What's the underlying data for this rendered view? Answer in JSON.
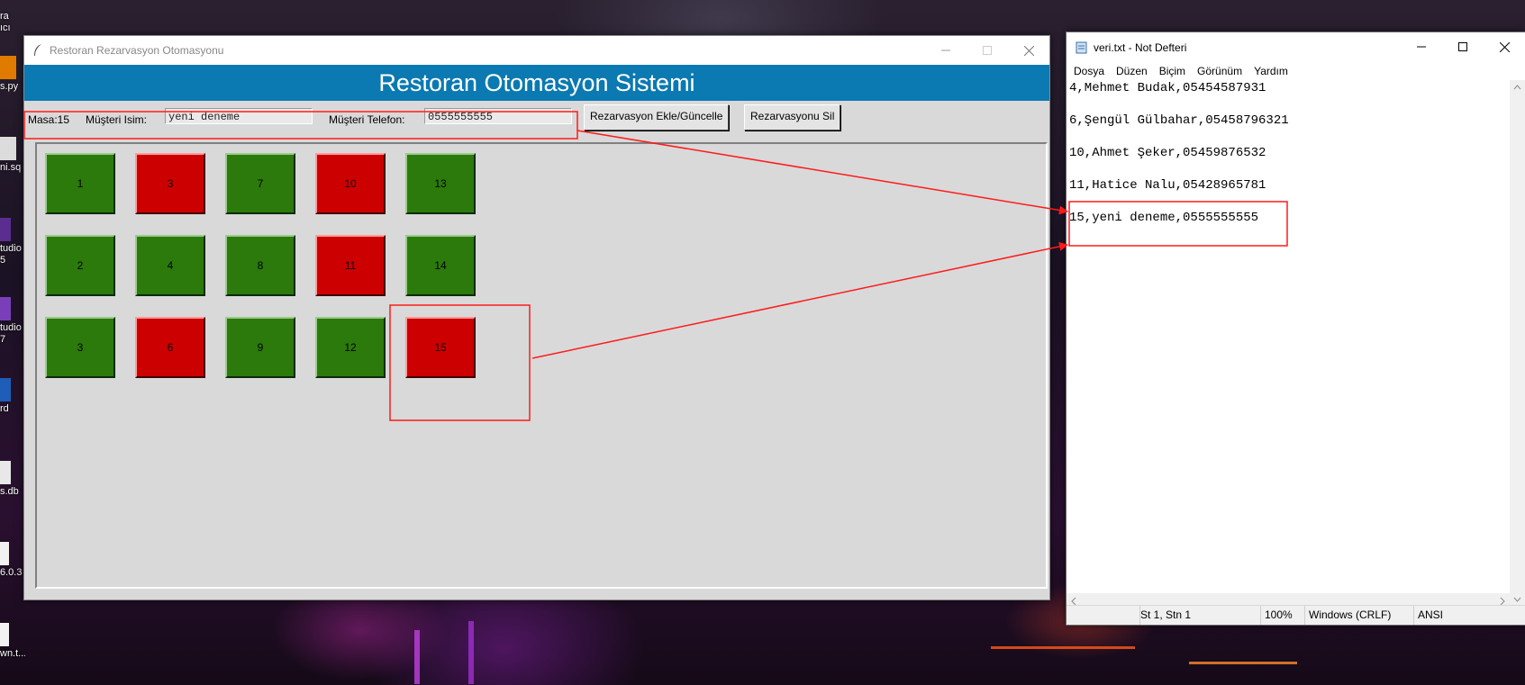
{
  "desktop": {
    "icons": [
      {
        "label": "ra\nıcı"
      },
      {
        "label": "s.py"
      },
      {
        "label": "ni.sq"
      },
      {
        "label": "tudio\n5"
      },
      {
        "label": "tudio\n7"
      },
      {
        "label": "rd"
      },
      {
        "label": "s.db"
      },
      {
        "label": "6.0.3"
      },
      {
        "label": "wn.t..."
      }
    ]
  },
  "tk_window": {
    "title": "Restoran Rezarvasyon Otomasyonu",
    "banner": "Restoran Otomasyon Sistemi",
    "banner_color": "#0b79b2",
    "masa_label": "Masa:15",
    "name_label": "Müşteri Isim:",
    "name_value": "yeni deneme",
    "phone_label": "Müşteri Telefon:",
    "phone_value": "0555555555",
    "add_button": "Rezarvasyon Ekle/Güncelle",
    "delete_button": "Rezarvasyonu Sil",
    "free_color": "#2b7a0b",
    "busy_color": "#cc0000",
    "tables": [
      {
        "label": "1",
        "status": "free"
      },
      {
        "label": "3",
        "status": "busy"
      },
      {
        "label": "7",
        "status": "free"
      },
      {
        "label": "10",
        "status": "busy"
      },
      {
        "label": "13",
        "status": "free"
      },
      {
        "label": "2",
        "status": "free"
      },
      {
        "label": "4",
        "status": "free"
      },
      {
        "label": "8",
        "status": "free"
      },
      {
        "label": "11",
        "status": "busy"
      },
      {
        "label": "14",
        "status": "free"
      },
      {
        "label": "3",
        "status": "free"
      },
      {
        "label": "6",
        "status": "busy"
      },
      {
        "label": "9",
        "status": "free"
      },
      {
        "label": "12",
        "status": "free"
      },
      {
        "label": "15",
        "status": "busy"
      }
    ]
  },
  "notepad": {
    "title": "veri.txt - Not Defteri",
    "menu": [
      "Dosya",
      "Düzen",
      "Biçim",
      "Görünüm",
      "Yardım"
    ],
    "lines": [
      "4,Mehmet Budak,05454587931",
      "6,Şengül Gülbahar,05458796321",
      "10,Ahmet Şeker,05459876532",
      "11,Hatice Nalu,05428965781",
      "15,yeni deneme,0555555555"
    ],
    "status": {
      "position": "St 1, Stn 1",
      "zoom": "100%",
      "line_endings": "Windows (CRLF)",
      "encoding": "ANSI"
    }
  },
  "annotation_color": "#ff1a1a"
}
